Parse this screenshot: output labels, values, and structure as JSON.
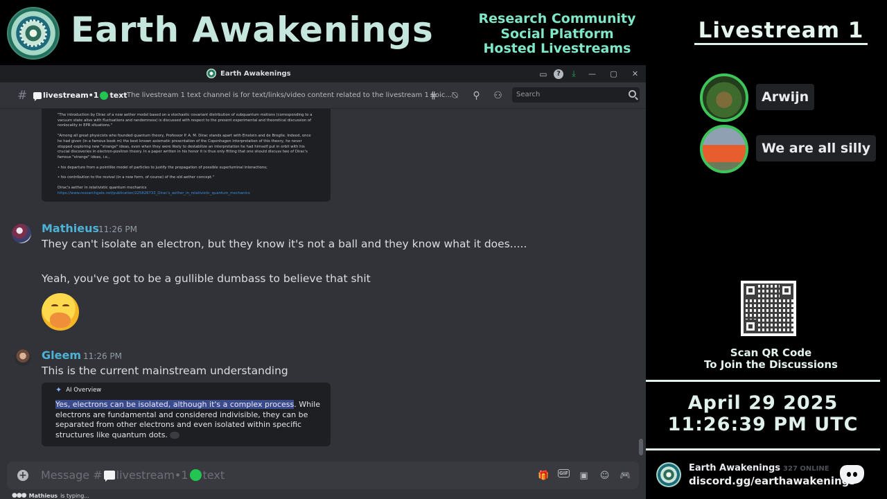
{
  "banner": {
    "title": "Earth Awakenings",
    "taglines": [
      "Research Community",
      "Social Platform",
      "Hosted Livestreams"
    ]
  },
  "window": {
    "title": "Earth Awakenings"
  },
  "channel": {
    "name_prefix": "livestream•1",
    "name_suffix": "text",
    "topic": "The livestream 1 text channel is for text/links/video content related to the livestream 1 voic...",
    "search_placeholder": "Search"
  },
  "embed_top": {
    "paragraphs": [
      "\"The introduction by Dirac of a new aether model based on a stochastic covariant distribution of subquantum motions (corresponding to a vacuum state alive with fluctuations and randomness) is discussed with respect to the present experimental and theoretical discussion of nonlocality in EPR situations.\"",
      "\"Among all great physicists who founded quantum theory, Professor P. A. M. Dirac stands apart with Einstein and de Broglie. Indeed, once he had given (in a famous book m) the best known axiomatic presentation of the Copenhagen interpretation of this theory, he never stopped exploring new \"strange\" ideas, even when they were likely to destabilize an interpretation he had himself put in orbit with his crucial discoveries in electron-positron theory. In a paper written in his honor it is thus only fitting that one should discuss two of Dirac's famous \"strange\" ideas, i.e.,",
      "• his departure from a pointlike model of particles to justify the propagation of possible superluminal interactions;",
      "• his contribution to the revival (in a new form, of course) of the old aether concept.\"",
      "Dirac's aether in relativistic quantum mechanics"
    ],
    "link": "https://www.researchgate.net/publication/225826733_Dirac's_aether_in_relativistic_quantum_mechanics"
  },
  "messages": [
    {
      "username": "Mathieus",
      "timestamp": "11:26 PM",
      "lines": [
        "They can't isolate an electron, but they know it's not a ball and they know what it does.....",
        "Yeah, you've got to be a gullible dumbass to believe that shit"
      ]
    },
    {
      "username": "Gleem",
      "timestamp": "11:26 PM",
      "lines": [
        "This is the current mainstream understanding"
      ],
      "embed": {
        "header": "AI Overview",
        "highlight": "Yes, electrons can be isolated, although it's a complex process",
        "rest": ". While electrons are fundamental and considered indivisible, they can be separated from other electrons and even isolated within specific structures like quantum dots."
      }
    }
  ],
  "composer": {
    "placeholder_prefix": "Message #",
    "placeholder_channel": "livestream•1",
    "placeholder_suffix": "text"
  },
  "typing": {
    "user": "Mathieus",
    "text": "is typing..."
  },
  "sidebar": {
    "title": "Livestream 1",
    "participants": [
      {
        "name": "Arwijn"
      },
      {
        "name": "We are all silly"
      }
    ],
    "scan_line1": "Scan QR Code",
    "scan_line2": "To Join the Discussions",
    "date": "April 29 2025",
    "time": "11:26:39 PM UTC",
    "server_name": "Earth Awakenings",
    "online": "327 ONLINE",
    "invite": "discord.gg/earthawakenings"
  },
  "colors": {
    "accent_teal": "#7fe6c8",
    "username_blue": "#4db3d6",
    "speaking_green": "#3ec45a",
    "discord_bg": "#313338"
  }
}
